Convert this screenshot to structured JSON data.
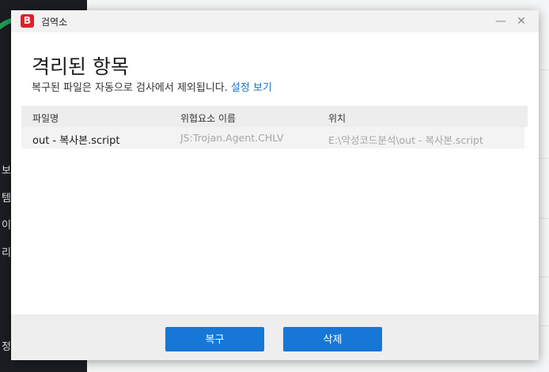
{
  "background": {
    "side_items": [
      "보",
      "템",
      "이",
      "리",
      "정"
    ]
  },
  "window": {
    "logo": "B",
    "title": "검역소",
    "minimize": "—",
    "close": "✕"
  },
  "page": {
    "title": "격리된 항목",
    "subtitle": "복구된 파일은 자동으로 검사에서 제외됩니다.",
    "settings_link": "설정 보기"
  },
  "table": {
    "columns": [
      "파일명",
      "위협요소 이름",
      "위치"
    ],
    "rows": [
      {
        "file": "out - 복사본.script",
        "threat": "JS:Trojan.Agent.CHLV",
        "location": "E:\\악성코드분석\\out - 복사본.script"
      }
    ]
  },
  "actions": {
    "restore": "복구",
    "delete": "삭제"
  }
}
